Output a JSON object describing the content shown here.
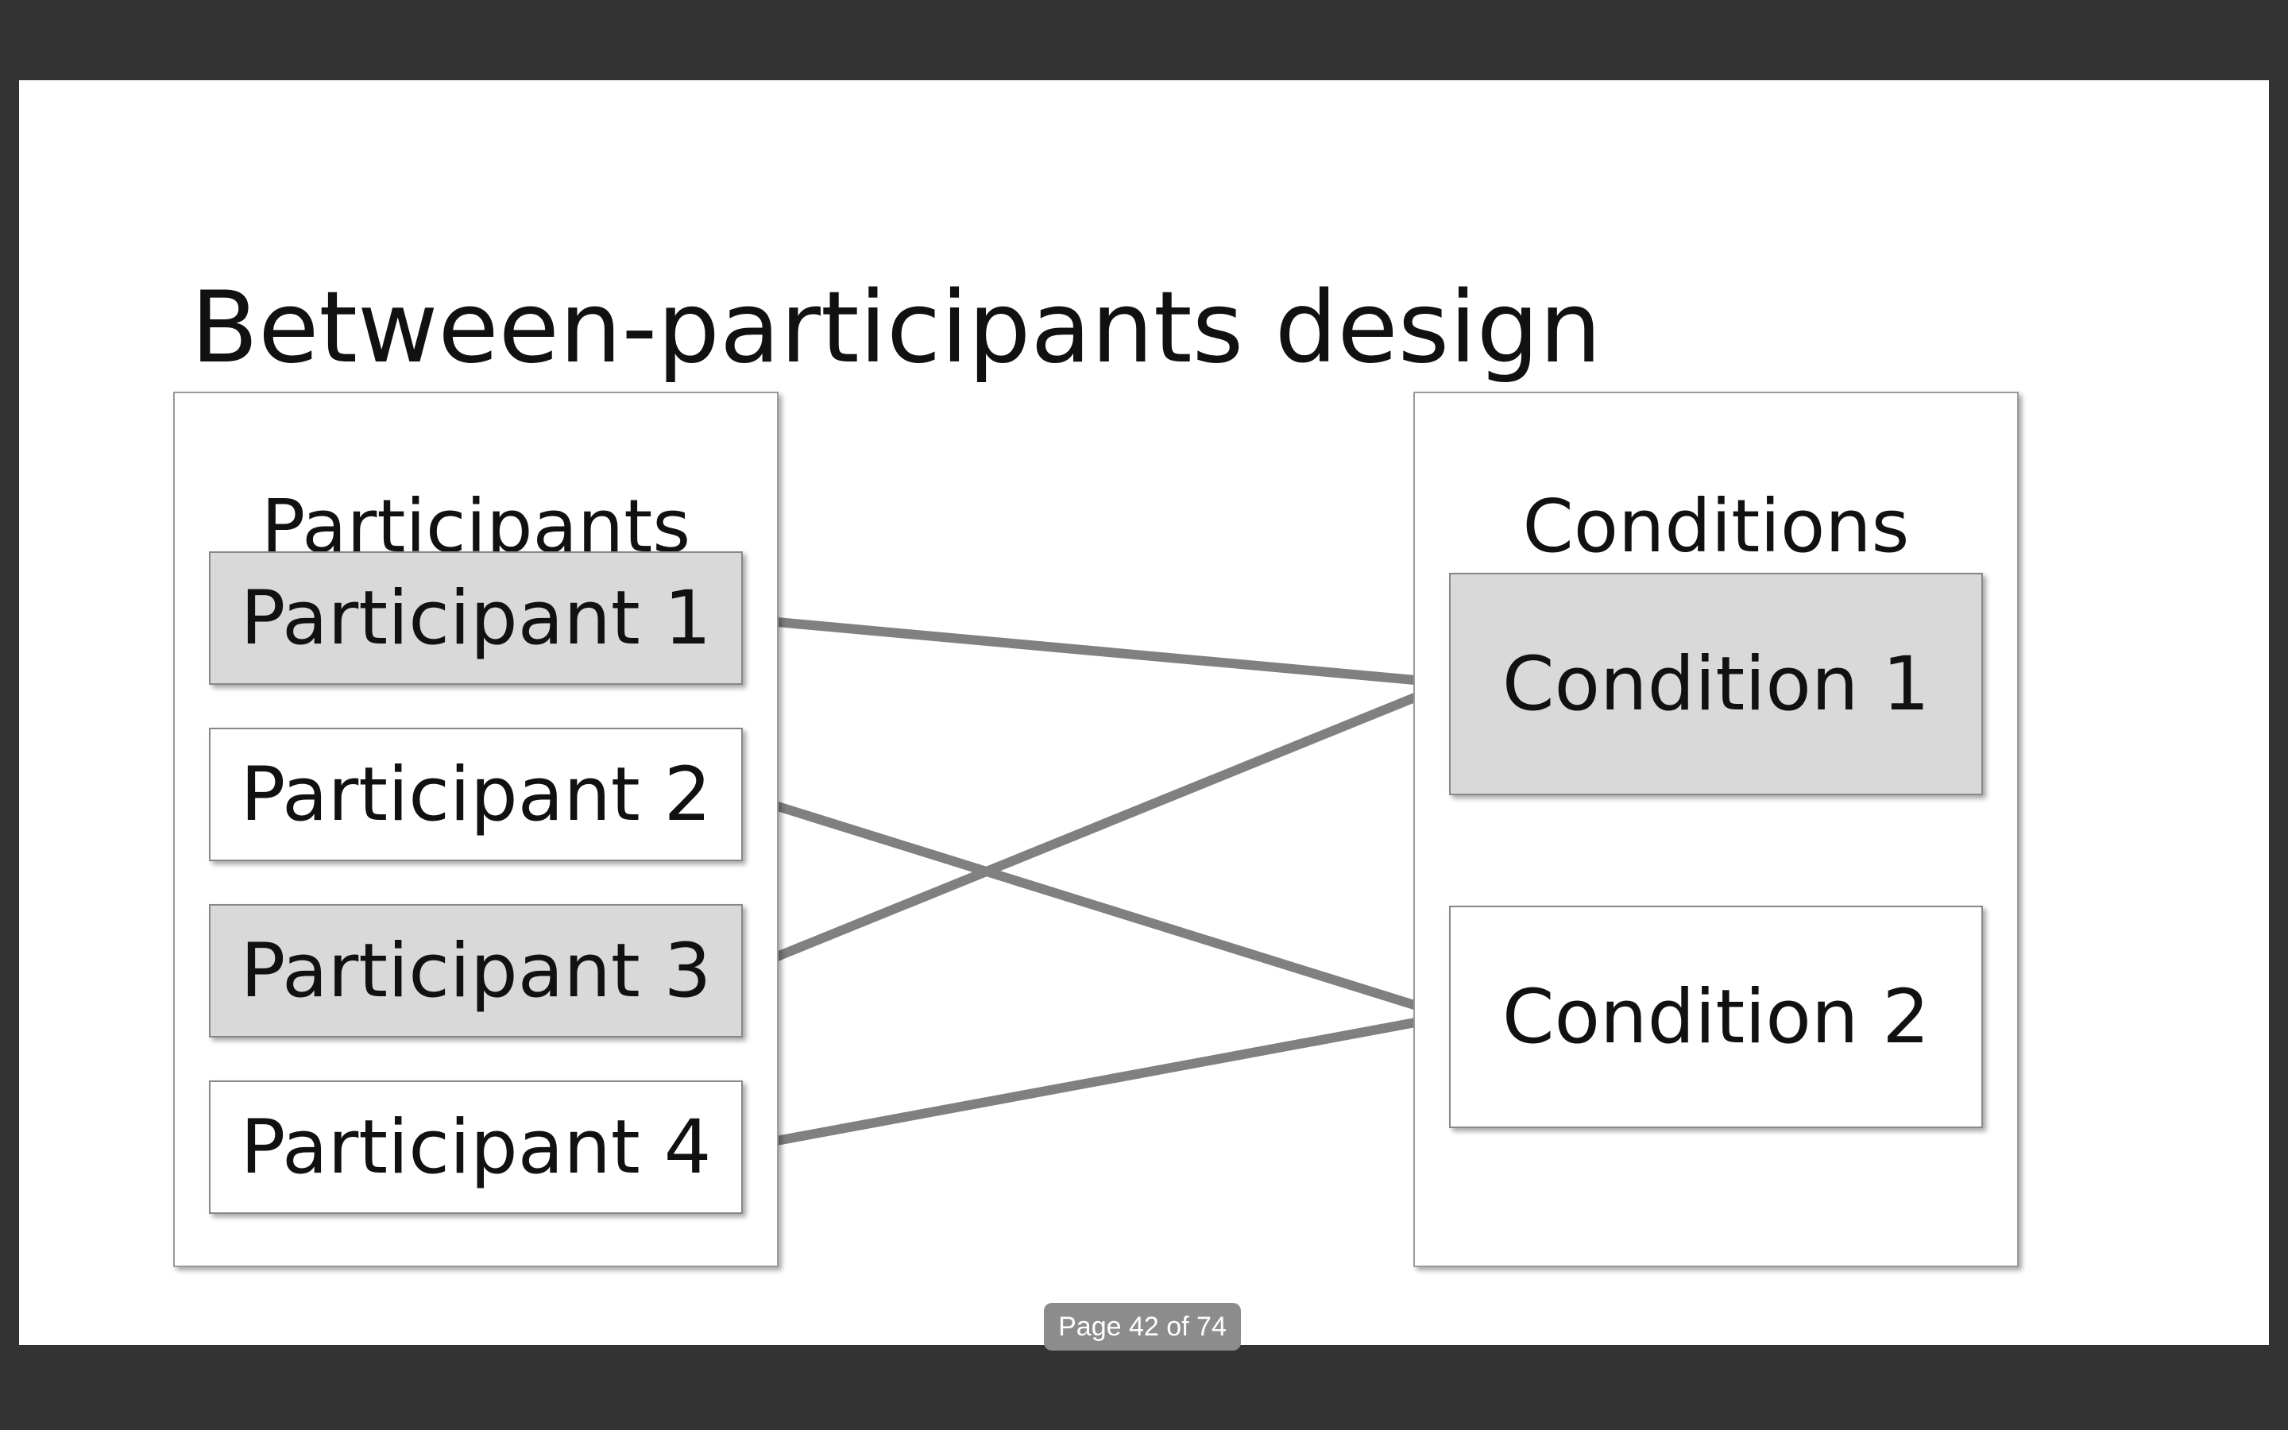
{
  "slide": {
    "title": "Between-participants design",
    "participants_panel": {
      "title": "Participants",
      "items": [
        {
          "label": "Participant 1",
          "fill": "#d9d9d9"
        },
        {
          "label": "Participant 2",
          "fill": "#ffffff"
        },
        {
          "label": "Participant 3",
          "fill": "#d9d9d9"
        },
        {
          "label": "Participant 4",
          "fill": "#ffffff"
        }
      ]
    },
    "conditions_panel": {
      "title": "Conditions",
      "items": [
        {
          "label": "Condition 1",
          "fill": "#d9d9d9"
        },
        {
          "label": "Condition 2",
          "fill": "#ffffff"
        }
      ]
    },
    "connector_color": "#808080"
  },
  "viewer": {
    "background_color": "#333333",
    "page_indicator": "Page 42 of 74"
  }
}
